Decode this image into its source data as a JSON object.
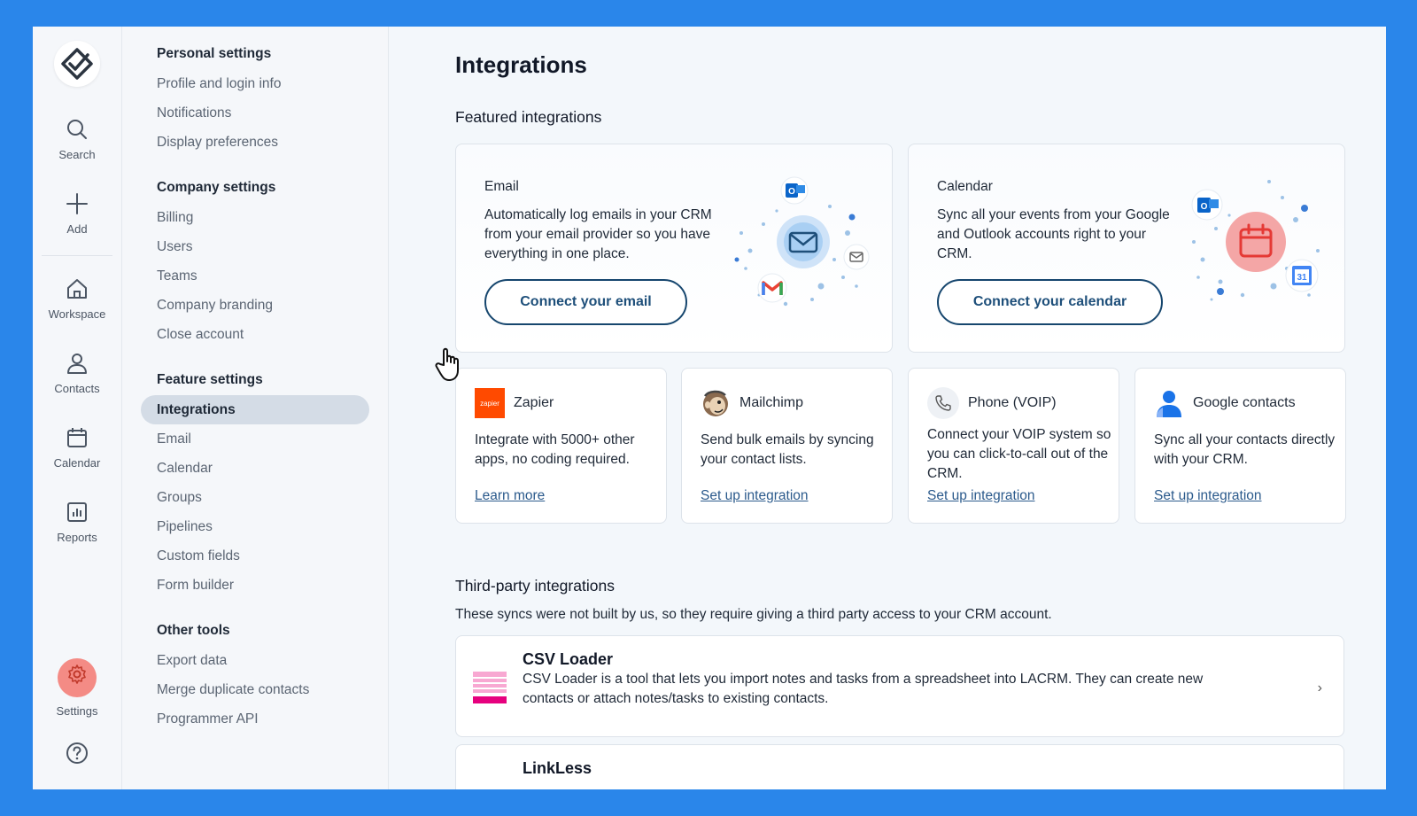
{
  "rail": {
    "items": [
      {
        "label": "Search",
        "icon": "search-icon"
      },
      {
        "label": "Add",
        "icon": "plus-icon"
      },
      {
        "label": "Workspace",
        "icon": "home-icon"
      },
      {
        "label": "Contacts",
        "icon": "person-icon"
      },
      {
        "label": "Calendar",
        "icon": "calendar-icon"
      },
      {
        "label": "Reports",
        "icon": "chart-icon"
      },
      {
        "label": "Settings",
        "icon": "gear-icon"
      }
    ],
    "settings_accent": "#f48b85"
  },
  "sidenav": {
    "personal": {
      "heading": "Personal settings",
      "items": [
        "Profile and login info",
        "Notifications",
        "Display preferences"
      ]
    },
    "company": {
      "heading": "Company settings",
      "items": [
        "Billing",
        "Users",
        "Teams",
        "Company branding",
        "Close account"
      ]
    },
    "feature": {
      "heading": "Feature settings",
      "items": [
        "Integrations",
        "Email",
        "Calendar",
        "Groups",
        "Pipelines",
        "Custom fields",
        "Form builder"
      ],
      "active": "Integrations"
    },
    "other": {
      "heading": "Other tools",
      "items": [
        "Export data",
        "Merge duplicate contacts",
        "Programmer API"
      ]
    }
  },
  "main": {
    "title": "Integrations",
    "featured_heading": "Featured integrations",
    "featured": [
      {
        "title": "Email",
        "desc": "Automatically log emails in your CRM from your email provider so you have everything in one place.",
        "button": "Connect your email"
      },
      {
        "title": "Calendar",
        "desc": "Sync all your events from your Google and Outlook accounts right to your CRM.",
        "button": "Connect your calendar"
      }
    ],
    "small": [
      {
        "name": "Zapier",
        "desc": "Integrate with 5000+ other apps, no coding required.",
        "link": "Learn more",
        "logo_text": "zapier"
      },
      {
        "name": "Mailchimp",
        "desc": "Send bulk emails by syncing your contact lists.",
        "link": "Set up integration"
      },
      {
        "name": "Phone (VOIP)",
        "desc": "Connect your VOIP system so you can click-to-call out of the CRM.",
        "link": "Set up integration"
      },
      {
        "name": "Google contacts",
        "desc": "Sync all your contacts directly with your CRM.",
        "link": "Set up integration"
      }
    ],
    "third_party_heading": "Third-party integrations",
    "third_party_desc": "These syncs were not built by us, so they require giving a third party access to your CRM account.",
    "third_party": [
      {
        "title": "CSV Loader",
        "desc": "CSV Loader is a tool that lets you import notes and tasks from a spreadsheet into LACRM. They can create new contacts or attach notes/tasks to existing contacts."
      },
      {
        "title": "LinkLess",
        "desc": ""
      }
    ],
    "calendar_badge": "31"
  },
  "colors": {
    "frame": "#2a86ea",
    "button_border": "#16466e",
    "link": "#2b5a8c",
    "zapier": "#ff4a00",
    "csv": "#e6007e"
  }
}
